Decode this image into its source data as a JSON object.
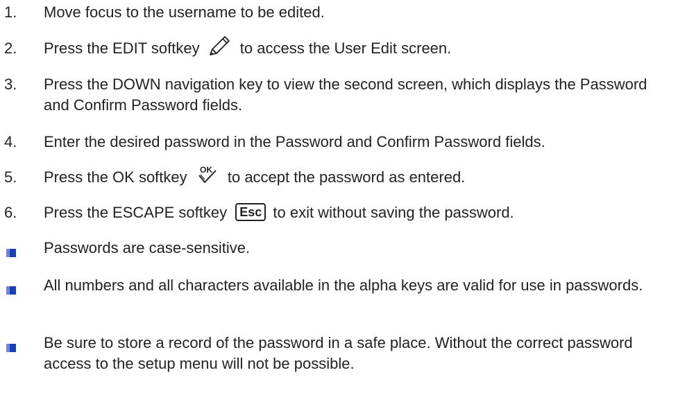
{
  "steps": [
    {
      "num": "1.",
      "text": "Move focus to the username to be edited."
    },
    {
      "num": "2.",
      "before": "Press the EDIT softkey",
      "icon": "pencil-icon",
      "after": "to access the User Edit screen."
    },
    {
      "num": "3.",
      "text": "Press the DOWN navigation key to view the second screen, which displays the Password and Confirm Password fields."
    },
    {
      "num": "4.",
      "text": "Enter the desired password in the Password and Confirm Password fields."
    },
    {
      "num": "5.",
      "before": "Press the OK softkey",
      "icon": "ok-check-icon",
      "icon_label": "OK",
      "after": "to accept the password as entered."
    },
    {
      "num": "6.",
      "before": "Press the ESCAPE softkey",
      "key_label": "Esc",
      "after": "to exit without saving the password."
    }
  ],
  "notes": [
    "Passwords are case-sensitive.",
    "All numbers and all characters available in the alpha keys are valid for use in passwords.",
    "Be sure to store a record of the password in a safe place. Without the correct password access to the setup menu will not be possible."
  ],
  "colors": {
    "bullet": "#1a3fb5",
    "bullet_highlight": "#6f86d8",
    "text": "#222222"
  }
}
